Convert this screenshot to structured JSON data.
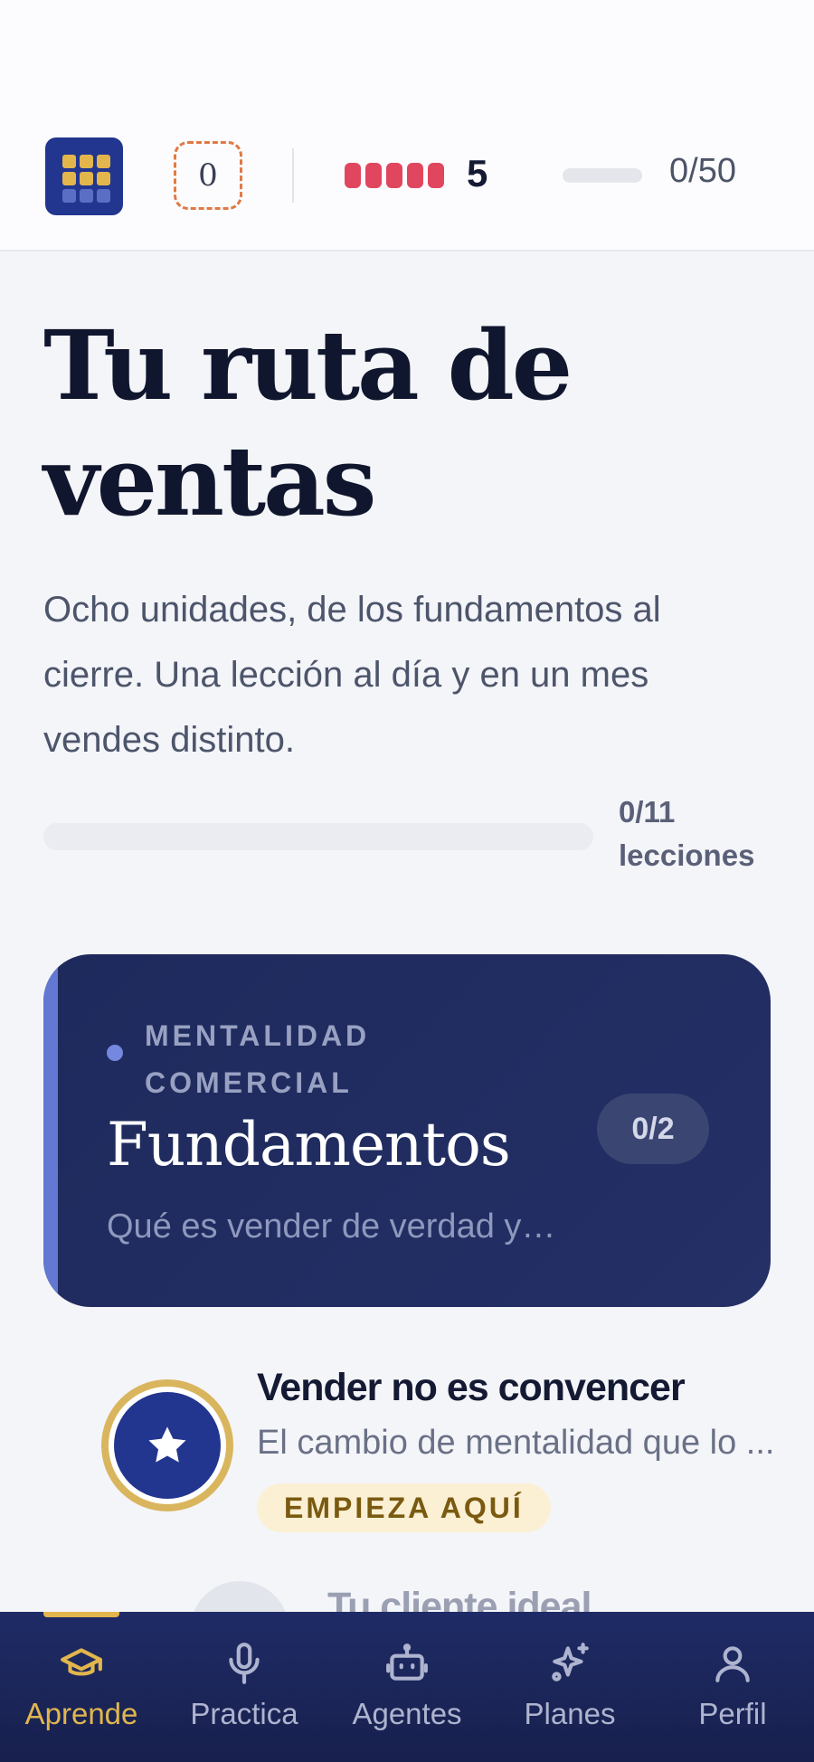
{
  "header": {
    "streak_value": "0",
    "lives_count": "5",
    "xp_progress": "0/50",
    "xp_fraction": 0,
    "colors": {
      "accent_gold": "#e2b64d",
      "brand_blue": "#22368f",
      "hearts_red": "#e1465f",
      "streak_orange": "#e07a45"
    }
  },
  "hero": {
    "title": "Tu ruta de ventas",
    "subtitle": "Ocho unidades, de los fundamentos al cierre. Una lección al día y en un mes vendes distinto.",
    "progress_label": "0/11 lecciones",
    "progress_fraction": 0
  },
  "unit": {
    "kicker": "MENTALIDAD COMERCIAL",
    "title": "Fundamentos",
    "description": "Qué es vender de verdad y…",
    "progress": "0/2"
  },
  "lessons": [
    {
      "title": "Vender no es convencer",
      "description": "El cambio de mentalidad que lo ...",
      "tag": "EMPIEZA AQUÍ",
      "icon": "star-icon"
    },
    {
      "title": "Tu cliente ideal"
    }
  ],
  "nav": {
    "items": [
      {
        "label": "Aprende",
        "icon": "graduation-cap-icon",
        "active": true
      },
      {
        "label": "Practica",
        "icon": "microphone-icon"
      },
      {
        "label": "Agentes",
        "icon": "robot-icon"
      },
      {
        "label": "Planes",
        "icon": "sparkles-icon"
      },
      {
        "label": "Perfil",
        "icon": "user-icon"
      }
    ]
  }
}
